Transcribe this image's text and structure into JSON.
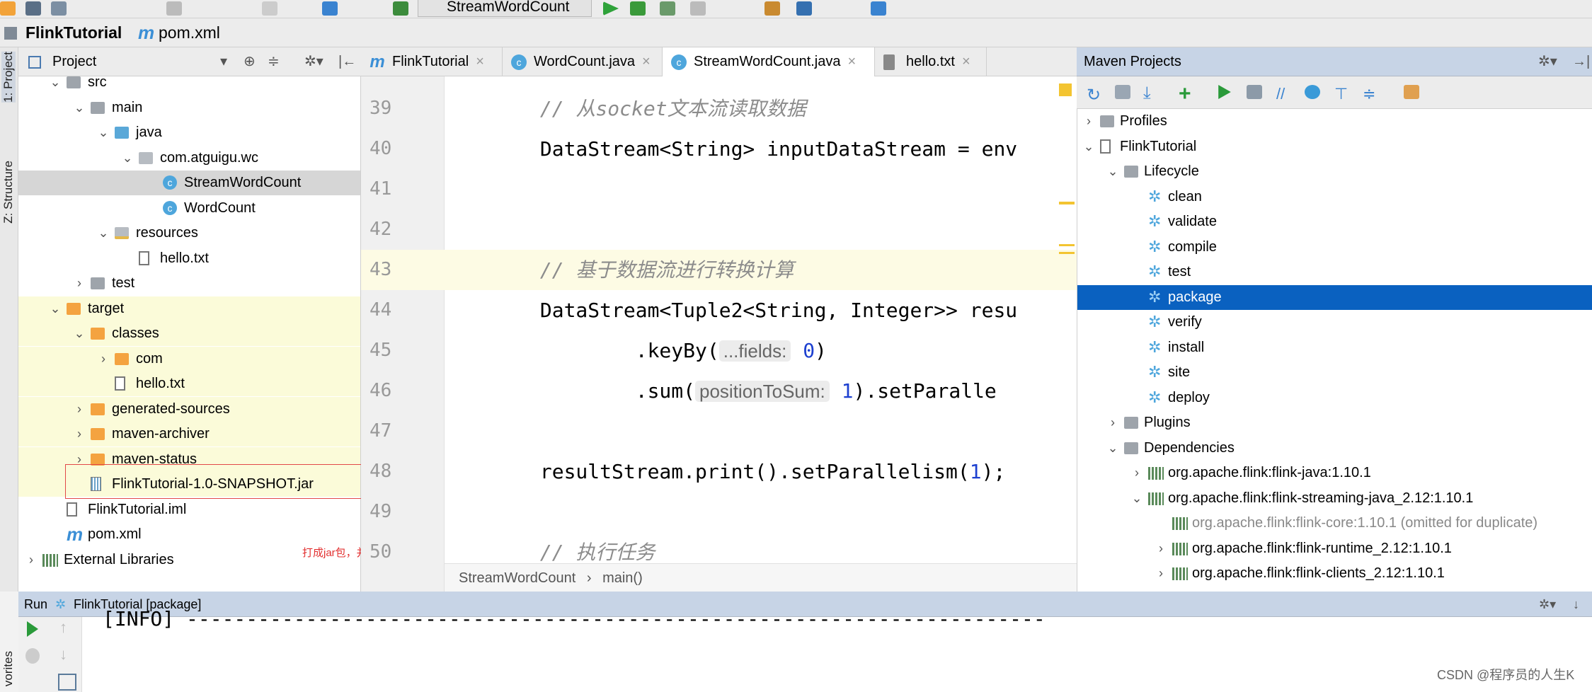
{
  "toolbar": {
    "run_config": "StreamWordCount"
  },
  "navbar": {
    "crumbs": [
      "FlinkTutorial",
      "pom.xml"
    ]
  },
  "side_stripe": {
    "project": "1: Project",
    "structure": "Z: Structure",
    "favorites": "vorites"
  },
  "project_panel": {
    "title": "Project",
    "rows": [
      {
        "label": "src",
        "level": 1,
        "arrow": "v",
        "icon": "f-gray",
        "bg": ""
      },
      {
        "label": "main",
        "level": 2,
        "arrow": "v",
        "icon": "f-gray",
        "bg": ""
      },
      {
        "label": "java",
        "level": 3,
        "arrow": "v",
        "icon": "f-blue",
        "bg": ""
      },
      {
        "label": "com.atguigu.wc",
        "level": 4,
        "arrow": "v",
        "icon": "f-pkg",
        "bg": ""
      },
      {
        "label": "StreamWordCount",
        "level": 5,
        "arrow": "",
        "icon": "c-class",
        "bg": "sel"
      },
      {
        "label": "WordCount",
        "level": 5,
        "arrow": "",
        "icon": "c-class",
        "bg": ""
      },
      {
        "label": "resources",
        "level": 3,
        "arrow": "v",
        "icon": "f-res",
        "bg": ""
      },
      {
        "label": "hello.txt",
        "level": 4,
        "arrow": "",
        "icon": "f-file",
        "bg": ""
      },
      {
        "label": "test",
        "level": 2,
        "arrow": ">",
        "icon": "f-gray",
        "bg": ""
      },
      {
        "label": "target",
        "level": 1,
        "arrow": "v",
        "icon": "f-orange",
        "bg": "yel"
      },
      {
        "label": "classes",
        "level": 2,
        "arrow": "v",
        "icon": "f-orange",
        "bg": "yel"
      },
      {
        "label": "com",
        "level": 3,
        "arrow": ">",
        "icon": "f-orange",
        "bg": "yel"
      },
      {
        "label": "hello.txt",
        "level": 3,
        "arrow": "",
        "icon": "f-file",
        "bg": "yel"
      },
      {
        "label": "generated-sources",
        "level": 2,
        "arrow": ">",
        "icon": "f-orange",
        "bg": "yel"
      },
      {
        "label": "maven-archiver",
        "level": 2,
        "arrow": ">",
        "icon": "f-orange",
        "bg": "yel"
      },
      {
        "label": "maven-status",
        "level": 2,
        "arrow": ">",
        "icon": "f-orange",
        "bg": "yel"
      },
      {
        "label": "FlinkTutorial-1.0-SNAPSHOT.jar",
        "level": 2,
        "arrow": "",
        "icon": "f-jar",
        "bg": "yel"
      },
      {
        "label": "FlinkTutorial.iml",
        "level": 1,
        "arrow": "",
        "icon": "f-file",
        "bg": ""
      },
      {
        "label": "pom.xml",
        "level": 1,
        "arrow": "",
        "icon": "f-m",
        "bg": ""
      },
      {
        "label": "External Libraries",
        "level": 0,
        "arrow": ">",
        "icon": "f-lib",
        "bg": ""
      }
    ],
    "annotation": "打成jar包，并准备提交"
  },
  "editor": {
    "tabs": [
      {
        "label": "FlinkTutorial",
        "icon": "m"
      },
      {
        "label": "WordCount.java",
        "icon": "c"
      },
      {
        "label": "StreamWordCount.java",
        "icon": "c",
        "active": true
      },
      {
        "label": "hello.txt",
        "icon": "file"
      }
    ],
    "lines": [
      {
        "n": "39",
        "seg": [
          [
            "        // 从socket文本流读取数据",
            "cm"
          ]
        ]
      },
      {
        "n": "40",
        "seg": [
          [
            "        DataStream<String> inputDataStream = env",
            ""
          ]
        ]
      },
      {
        "n": "41",
        "seg": []
      },
      {
        "n": "42",
        "seg": []
      },
      {
        "n": "43",
        "hl": true,
        "seg": [
          [
            "        // 基于数据流进行转换计算",
            "cm"
          ]
        ]
      },
      {
        "n": "44",
        "seg": [
          [
            "        DataStream<Tuple2<String, Integer>> resu",
            ""
          ]
        ]
      },
      {
        "n": "45",
        "seg": [
          [
            "                .keyBy(",
            ""
          ],
          [
            "...fields:",
            "hint"
          ],
          [
            " ",
            ""
          ],
          [
            "0",
            "num"
          ],
          [
            ")",
            ""
          ]
        ]
      },
      {
        "n": "46",
        "seg": [
          [
            "                .sum(",
            ""
          ],
          [
            "positionToSum:",
            "hint"
          ],
          [
            " ",
            ""
          ],
          [
            "1",
            "num"
          ],
          [
            ").setParalle",
            ""
          ]
        ]
      },
      {
        "n": "47",
        "seg": []
      },
      {
        "n": "48",
        "seg": [
          [
            "        resultStream.print().setParallelism(",
            ""
          ],
          [
            "1",
            "num"
          ],
          [
            ");",
            ""
          ]
        ]
      },
      {
        "n": "49",
        "seg": []
      },
      {
        "n": "50",
        "seg": [
          [
            "        // 执行任务",
            "cm"
          ]
        ]
      }
    ],
    "breadcrumb": [
      "StreamWordCount",
      "main()"
    ]
  },
  "maven": {
    "title": "Maven Projects",
    "rows": [
      {
        "label": "Profiles",
        "level": 0,
        "arrow": ">",
        "icon": "folder"
      },
      {
        "label": "FlinkTutorial",
        "level": 0,
        "arrow": "v",
        "icon": "proj"
      },
      {
        "label": "Lifecycle",
        "level": 1,
        "arrow": "v",
        "icon": "folder"
      },
      {
        "label": "clean",
        "level": 2,
        "arrow": "",
        "icon": "gear"
      },
      {
        "label": "validate",
        "level": 2,
        "arrow": "",
        "icon": "gear"
      },
      {
        "label": "compile",
        "level": 2,
        "arrow": "",
        "icon": "gear"
      },
      {
        "label": "test",
        "level": 2,
        "arrow": "",
        "icon": "gear"
      },
      {
        "label": "package",
        "level": 2,
        "arrow": "",
        "icon": "gear",
        "sel": true
      },
      {
        "label": "verify",
        "level": 2,
        "arrow": "",
        "icon": "gear"
      },
      {
        "label": "install",
        "level": 2,
        "arrow": "",
        "icon": "gear"
      },
      {
        "label": "site",
        "level": 2,
        "arrow": "",
        "icon": "gear"
      },
      {
        "label": "deploy",
        "level": 2,
        "arrow": "",
        "icon": "gear"
      },
      {
        "label": "Plugins",
        "level": 1,
        "arrow": ">",
        "icon": "folder"
      },
      {
        "label": "Dependencies",
        "level": 1,
        "arrow": "v",
        "icon": "folder"
      },
      {
        "label": "org.apache.flink:flink-java:1.10.1",
        "level": 2,
        "arrow": ">",
        "icon": "lib"
      },
      {
        "label": "org.apache.flink:flink-streaming-java_2.12:1.10.1",
        "level": 2,
        "arrow": "v",
        "icon": "lib"
      },
      {
        "label": "org.apache.flink:flink-core:1.10.1 (omitted for duplicate)",
        "level": 3,
        "arrow": "",
        "icon": "lib",
        "omit": true
      },
      {
        "label": "org.apache.flink:flink-runtime_2.12:1.10.1",
        "level": 3,
        "arrow": ">",
        "icon": "lib"
      },
      {
        "label": "org.apache.flink:flink-clients_2.12:1.10.1",
        "level": 3,
        "arrow": ">",
        "icon": "lib"
      }
    ]
  },
  "run": {
    "label": "Run",
    "config": "FlinkTutorial [package]",
    "console": "[INFO] ------------------------------------------------------------------------"
  },
  "watermark": "CSDN @程序员的人生K"
}
